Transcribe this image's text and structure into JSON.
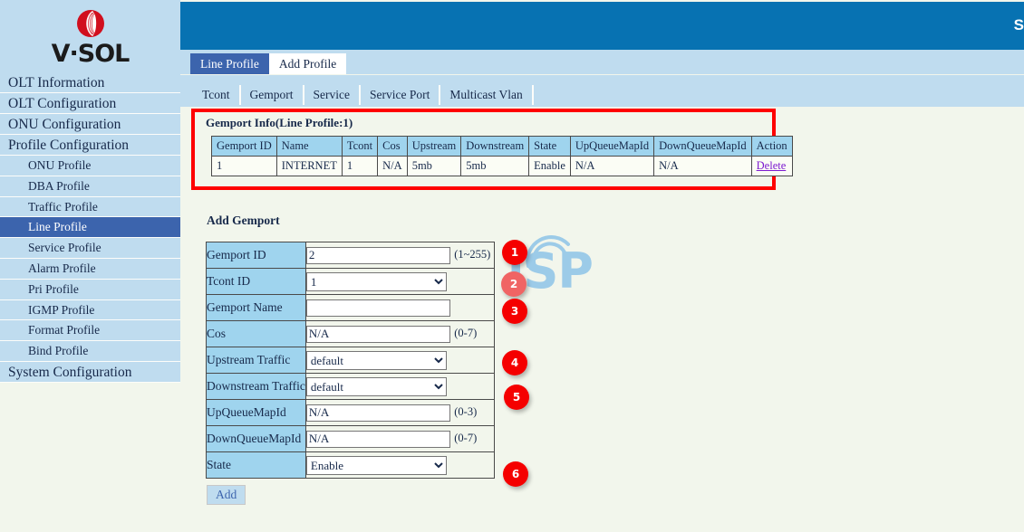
{
  "brand": {
    "name": "V·SOL",
    "logo_icon": "vsol-logo-icon"
  },
  "header": {
    "cut_text": "S"
  },
  "sidebar": {
    "top_items": [
      {
        "label": "OLT Information"
      },
      {
        "label": "OLT Configuration"
      },
      {
        "label": "ONU Configuration"
      },
      {
        "label": "Profile Configuration"
      }
    ],
    "sub_items": [
      {
        "label": "ONU Profile",
        "active": false
      },
      {
        "label": "DBA Profile",
        "active": false
      },
      {
        "label": "Traffic Profile",
        "active": false
      },
      {
        "label": "Line Profile",
        "active": true
      },
      {
        "label": "Service Profile",
        "active": false
      },
      {
        "label": "Alarm Profile",
        "active": false
      },
      {
        "label": "Pri Profile",
        "active": false
      },
      {
        "label": "IGMP Profile",
        "active": false
      },
      {
        "label": "Format Profile",
        "active": false
      },
      {
        "label": "Bind Profile",
        "active": false
      }
    ],
    "bottom_items": [
      {
        "label": "System Configuration"
      }
    ]
  },
  "tabs_primary": [
    {
      "label": "Line Profile",
      "active": true
    },
    {
      "label": "Add Profile",
      "active": false
    }
  ],
  "tabs_secondary": [
    {
      "label": "Tcont"
    },
    {
      "label": "Gemport"
    },
    {
      "label": "Service"
    },
    {
      "label": "Service Port"
    },
    {
      "label": "Multicast Vlan"
    }
  ],
  "info_panel": {
    "title": "Gemport Info(Line Profile:1)",
    "highlight_color": "#fe0000",
    "columns": [
      "Gemport ID",
      "Name",
      "Tcont",
      "Cos",
      "Upstream",
      "Downstream",
      "State",
      "UpQueueMapId",
      "DownQueueMapId",
      "Action"
    ],
    "rows": [
      {
        "gemport_id": "1",
        "name": "INTERNET",
        "tcont": "1",
        "cos": "N/A",
        "upstream": "5mb",
        "downstream": "5mb",
        "state": "Enable",
        "up_queue_map_id": "N/A",
        "down_queue_map_id": "N/A",
        "action": "Delete"
      }
    ]
  },
  "add_form": {
    "title": "Add Gemport",
    "submit_label": "Add",
    "fields": {
      "gemport_id": {
        "label": "Gemport ID",
        "value": "2",
        "hint": "(1~255)"
      },
      "tcont_id": {
        "label": "Tcont ID",
        "value": "1",
        "options": [
          "1"
        ]
      },
      "gemport_name": {
        "label": "Gemport Name",
        "value": "",
        "placeholder": ""
      },
      "cos": {
        "label": "Cos",
        "value": "N/A",
        "hint": "(0-7)"
      },
      "upstream_traffic": {
        "label": "Upstream Traffic",
        "value": "default",
        "options": [
          "default"
        ]
      },
      "downstream_traffic": {
        "label": "Downstream Traffic",
        "value": "default",
        "options": [
          "default"
        ]
      },
      "up_queue_map_id": {
        "label": "UpQueueMapId",
        "value": "N/A",
        "hint": "(0-3)"
      },
      "down_queue_map_id": {
        "label": "DownQueueMapId",
        "value": "N/A",
        "hint": "(0-7)"
      },
      "state": {
        "label": "State",
        "value": "Enable",
        "options": [
          "Enable"
        ]
      }
    }
  },
  "annotation_badges": [
    {
      "number": "1",
      "faded": false
    },
    {
      "number": "2",
      "faded": true
    },
    {
      "number": "3",
      "faded": false
    },
    {
      "number": "4",
      "faded": false
    },
    {
      "number": "5",
      "faded": false
    },
    {
      "number": "6",
      "faded": false
    }
  ],
  "watermark": {
    "text_white": "on",
    "text_blue": "iSP",
    "icon": "wifi-arc-icon"
  },
  "colors": {
    "header_blue": "#0772b2",
    "sidebar_blue": "#bfdcef",
    "active_blue": "#3c64ad",
    "table_header": "#9fd4ee",
    "page_bg": "#f2f6ec",
    "badge_red": "#f50000",
    "link_purple": "#7d1ad0"
  }
}
